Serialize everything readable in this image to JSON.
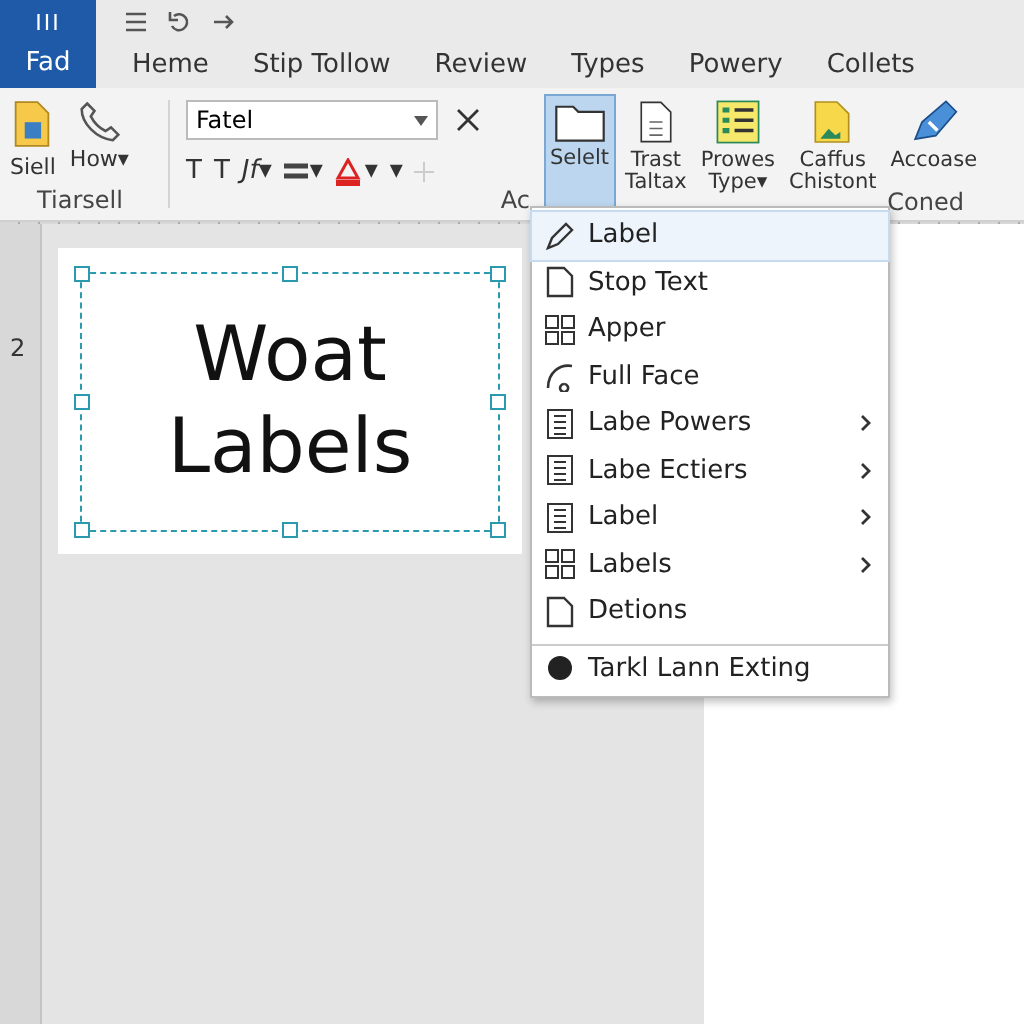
{
  "app_button": {
    "glyph": "III",
    "label": "Fad"
  },
  "tabs": [
    {
      "label": "Heme",
      "selected": false
    },
    {
      "label": "Stip Tollow",
      "selected": false
    },
    {
      "label": "Review",
      "selected": false
    },
    {
      "label": "Types",
      "selected": false
    },
    {
      "label": "Powery",
      "selected": false
    },
    {
      "label": "Collets",
      "selected": false
    }
  ],
  "ribbon": {
    "clipboard": {
      "buttons": [
        {
          "label": "Siell",
          "kind": "doc"
        },
        {
          "label": "How▾",
          "kind": "phone"
        }
      ],
      "group_label": "Tiarsell"
    },
    "font": {
      "font_field": "Fatel",
      "row": [
        "T",
        "T",
        "Jf▾",
        "▾",
        "▾",
        "▾"
      ],
      "group_label": "Ac"
    },
    "insert": {
      "buttons": [
        {
          "label": "Selelt",
          "kind": "folder",
          "selected": true
        },
        {
          "label": "Trast\nTaltax",
          "kind": "page",
          "selected": false
        },
        {
          "label": "Prowes\nType▾",
          "kind": "list",
          "selected": false
        },
        {
          "label": "Caffus\nChistont",
          "kind": "image",
          "selected": false
        },
        {
          "label": "Accoase",
          "kind": "pen",
          "selected": false
        }
      ],
      "group_label": "Coned"
    }
  },
  "ruler": {
    "vertical_mark": "2"
  },
  "label_card": {
    "lines": [
      "Woat",
      "Labels"
    ]
  },
  "menu": {
    "items": [
      {
        "label": "Label",
        "kind": "pen",
        "submenu": false,
        "selected": true,
        "separator_before": false
      },
      {
        "label": "Stop Text",
        "kind": "page",
        "submenu": false,
        "selected": false,
        "separator_before": false
      },
      {
        "label": "Apper",
        "kind": "grid",
        "submenu": false,
        "selected": false,
        "separator_before": false
      },
      {
        "label": "Full Face",
        "kind": "curve",
        "submenu": false,
        "selected": false,
        "separator_before": false
      },
      {
        "label": "Labe Powers",
        "kind": "list",
        "submenu": true,
        "selected": false,
        "separator_before": false
      },
      {
        "label": "Labe Ectiers",
        "kind": "list",
        "submenu": true,
        "selected": false,
        "separator_before": false
      },
      {
        "label": "Label",
        "kind": "list",
        "submenu": true,
        "selected": false,
        "separator_before": false
      },
      {
        "label": "Labels",
        "kind": "grid",
        "submenu": true,
        "selected": false,
        "separator_before": false
      },
      {
        "label": "Detions",
        "kind": "page",
        "submenu": false,
        "selected": false,
        "separator_before": false
      },
      {
        "label": "Tarkl Lann Exting",
        "kind": "disc",
        "submenu": false,
        "selected": false,
        "separator_before": true
      }
    ]
  }
}
